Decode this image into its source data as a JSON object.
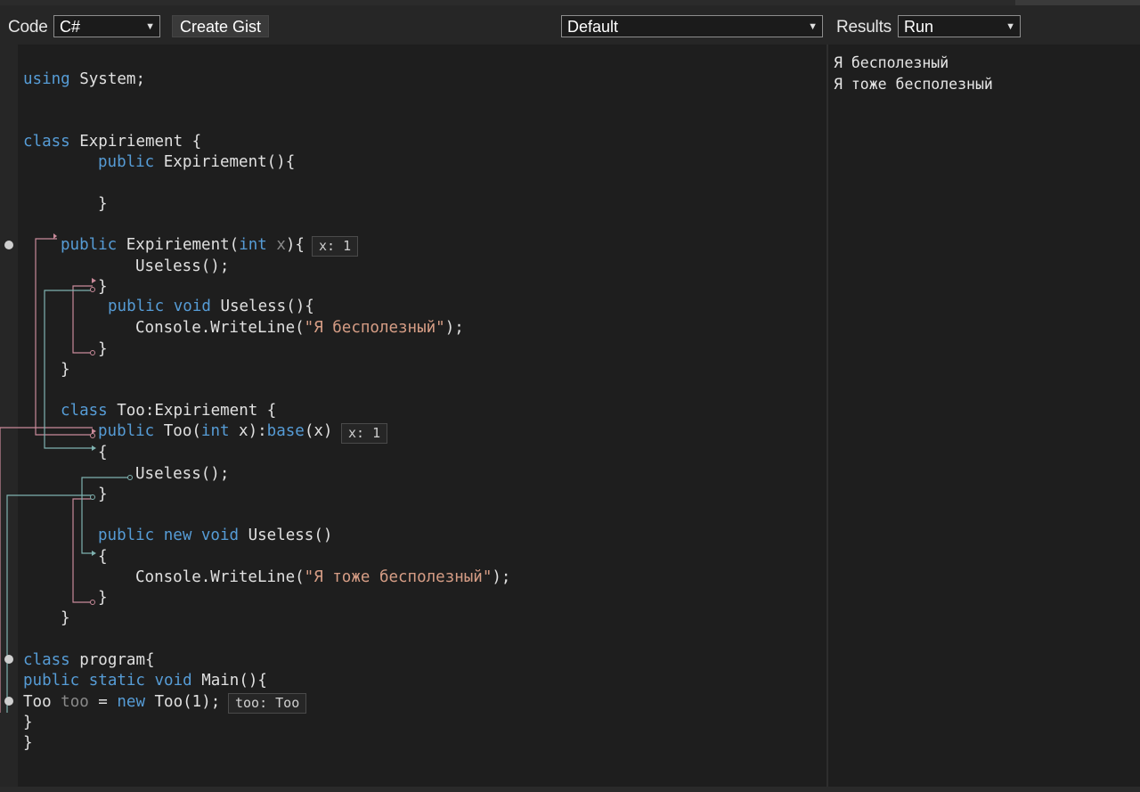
{
  "toolbar": {
    "code_label": "Code",
    "language": "C#",
    "create_gist": "Create Gist",
    "mode": "Default",
    "results_label": "Results",
    "run": "Run"
  },
  "code": {
    "l1_kw": "using",
    "l1_rest": " System;",
    "l2_kw": "class",
    "l2_rest": " Expiriement {",
    "l3_kw": "public",
    "l3_rest": " Expiriement(){",
    "l4": "}",
    "l5_kw": "public",
    "l5_mid": " Expiriement(",
    "l5_kw2": "int",
    "l5_var": " x",
    "l5_end": "){",
    "l6": "Useless();",
    "l7": "}",
    "l8_kw": "public void",
    "l8_rest": " Useless(){",
    "l9_a": "Console.WriteLine(",
    "l9_str": "\"Я бесполезный\"",
    "l9_b": ");",
    "l10": "}",
    "l11": "}",
    "l12_kw": "class",
    "l12_rest": " Too:Expiriement {",
    "l13_kw": "public",
    "l13_mid": " Too(",
    "l13_kw2": "int",
    "l13_mid2": " x):",
    "l13_kw3": "base",
    "l13_end": "(x)",
    "l14": "{",
    "l15": "Useless();",
    "l16": "}",
    "l17_kw": "public new void",
    "l17_rest": " Useless()",
    "l18": "{",
    "l19_a": "Console.WriteLine(",
    "l19_str": "\"Я тоже бесполезный\"",
    "l19_b": ");",
    "l20": "}",
    "l21": "}",
    "l22_kw": "class",
    "l22_rest": " program{",
    "l23_kw": "public static void",
    "l23_rest": " Main(){",
    "l24_a": "Too ",
    "l24_var": "too",
    "l24_b": " = ",
    "l24_kw": "new",
    "l24_c": " Too(1);",
    "l25": "}",
    "l26": "}"
  },
  "hints": {
    "h1": "x: 1",
    "h2": "x: 1",
    "h3": "too: Too"
  },
  "results": {
    "line1": "Я бесполезный",
    "line2": "Я тоже бесполезный"
  }
}
